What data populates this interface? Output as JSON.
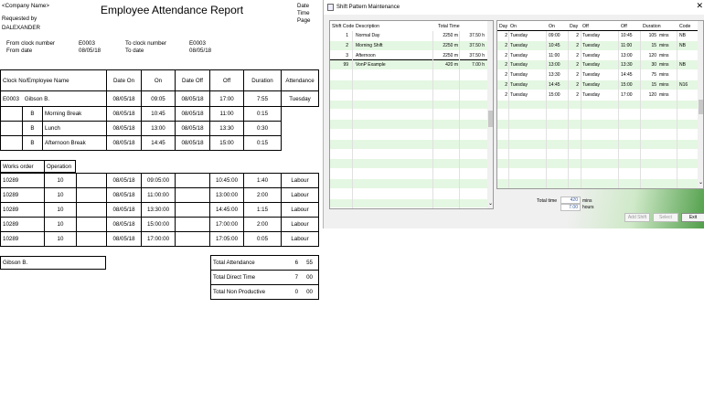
{
  "report": {
    "company": "<Company Name>",
    "title": "Employee Attendance Report",
    "requested_by_label": "Requested by",
    "requested_by": "DALEXANDER",
    "meta_labels": [
      "Date",
      "Time",
      "Page"
    ],
    "from_clock_label": "From clock number",
    "from_clock": "E0003",
    "to_clock_label": "To clock number",
    "to_clock": "E0003",
    "from_date_label": "From date",
    "from_date": "08/05/18",
    "to_date_label": "To date",
    "to_date": "08/05/18",
    "headers": {
      "clock_name": "Clock No/Employee Name",
      "date_on": "Date On",
      "on": "On",
      "date_off": "Date Off",
      "off": "Off",
      "duration": "Duration",
      "attendance": "Attendance"
    },
    "employee": {
      "clock": "E0003",
      "name": "Gibson B.",
      "date_on": "08/05/18",
      "on": "09:05",
      "date_off": "08/05/18",
      "off": "17:00",
      "duration": "7:55",
      "attendance": "Tuesday"
    },
    "breaks": [
      {
        "code": "B",
        "name": "Morning Break",
        "date_on": "08/05/18",
        "on": "10:45",
        "date_off": "08/05/18",
        "off": "11:00",
        "duration": "0:15"
      },
      {
        "code": "B",
        "name": "Lunch",
        "date_on": "08/05/18",
        "on": "13:00",
        "date_off": "08/05/18",
        "off": "13:30",
        "duration": "0:30"
      },
      {
        "code": "B",
        "name": "Afternoon Break",
        "date_on": "08/05/18",
        "on": "14:45",
        "date_off": "08/05/18",
        "off": "15:00",
        "duration": "0:15"
      }
    ],
    "works_headers": {
      "works_order": "Works order",
      "operation": "Operation"
    },
    "works": [
      {
        "order": "10289",
        "op": "10",
        "date_on": "08/05/18",
        "on": "09:05:00",
        "off": "10:45:00",
        "duration": "1:40",
        "type": "Labour"
      },
      {
        "order": "10289",
        "op": "10",
        "date_on": "08/05/18",
        "on": "11:00:00",
        "off": "13:00:00",
        "duration": "2:00",
        "type": "Labour"
      },
      {
        "order": "10289",
        "op": "10",
        "date_on": "08/05/18",
        "on": "13:30:00",
        "off": "14:45:00",
        "duration": "1:15",
        "type": "Labour"
      },
      {
        "order": "10289",
        "op": "10",
        "date_on": "08/05/18",
        "on": "15:00:00",
        "off": "17:00:00",
        "duration": "2:00",
        "type": "Labour"
      },
      {
        "order": "10289",
        "op": "10",
        "date_on": "08/05/18",
        "on": "17:00:00",
        "off": "17:05:00",
        "duration": "0:05",
        "type": "Labour"
      }
    ],
    "summary_name": "Gibson B.",
    "totals": [
      {
        "label": "Total Attendance",
        "h": "6",
        "m": "55"
      },
      {
        "label": "Total Direct Time",
        "h": "7",
        "m": "00"
      },
      {
        "label": "Total Non Productive",
        "h": "0",
        "m": "00"
      }
    ]
  },
  "dialog": {
    "title": "Shift Pattern Maintenance",
    "close_glyph": "✕",
    "left_headers": {
      "code": "Shift Code",
      "desc": "Description",
      "total": "Total Time"
    },
    "shifts": [
      {
        "code": "1",
        "desc": "Normal Day",
        "mins": "2250 m",
        "hours": "37.50 h"
      },
      {
        "code": "2",
        "desc": "Morning Shift",
        "mins": "2250 m",
        "hours": "37.50 h"
      },
      {
        "code": "3",
        "desc": "Afternoon",
        "mins": "2250 m",
        "hours": "37.50 h"
      },
      {
        "code": "99",
        "desc": "VonP Example",
        "mins": "420 m",
        "hours": "7.00 h"
      }
    ],
    "right_headers": {
      "day": "Day",
      "on": "On",
      "on_time": "On",
      "day2": "Day",
      "off": "Off",
      "off_time": "Off",
      "duration": "Duration",
      "code": "Code"
    },
    "pattern": [
      {
        "day": "2",
        "on": "Tuesday",
        "on_time": "09:00",
        "day2": "2",
        "off": "Tuesday",
        "off_time": "10:45",
        "dur": "105",
        "unit": "mins",
        "code": "NB"
      },
      {
        "day": "2",
        "on": "Tuesday",
        "on_time": "10:45",
        "day2": "2",
        "off": "Tuesday",
        "off_time": "11:00",
        "dur": "15",
        "unit": "mins",
        "code": "NB"
      },
      {
        "day": "2",
        "on": "Tuesday",
        "on_time": "11:00",
        "day2": "2",
        "off": "Tuesday",
        "off_time": "13:00",
        "dur": "120",
        "unit": "mins",
        "code": ""
      },
      {
        "day": "2",
        "on": "Tuesday",
        "on_time": "13:00",
        "day2": "2",
        "off": "Tuesday",
        "off_time": "13:30",
        "dur": "30",
        "unit": "mins",
        "code": "NB"
      },
      {
        "day": "2",
        "on": "Tuesday",
        "on_time": "13:30",
        "day2": "2",
        "off": "Tuesday",
        "off_time": "14:45",
        "dur": "75",
        "unit": "mins",
        "code": ""
      },
      {
        "day": "2",
        "on": "Tuesday",
        "on_time": "14:45",
        "day2": "2",
        "off": "Tuesday",
        "off_time": "15:00",
        "dur": "15",
        "unit": "mins",
        "code": "N16"
      },
      {
        "day": "2",
        "on": "Tuesday",
        "on_time": "15:00",
        "day2": "2",
        "off": "Tuesday",
        "off_time": "17:00",
        "dur": "120",
        "unit": "mins",
        "code": ""
      }
    ],
    "total_time_label": "Total time",
    "total_mins": "420",
    "mins_label": "mins",
    "total_hours": "7.00",
    "hours_label": "hours",
    "buttons": {
      "add": "Add Shift",
      "select": "Select",
      "exit": "Exit"
    },
    "colors": {
      "band": "#e4f7e2",
      "accent": "#3c9a3a",
      "selection": "#fff"
    }
  }
}
